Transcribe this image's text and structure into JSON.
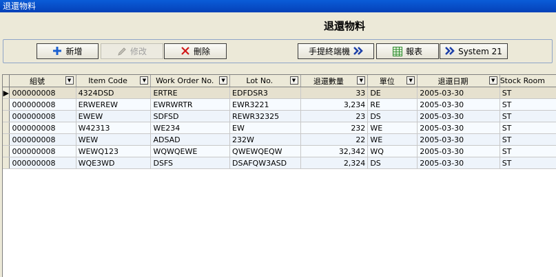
{
  "window": {
    "title": "退還物料"
  },
  "page": {
    "heading": "退還物料"
  },
  "toolbar": {
    "new_label": "新增",
    "edit_label": "修改",
    "delete_label": "刪除",
    "handheld_label": "手提終端機",
    "report_label": "報表",
    "system21_label": "System 21"
  },
  "icons": {
    "new": "plus-icon",
    "edit": "pencil-icon",
    "delete": "x-icon",
    "handheld": "double-chevron-right-icon",
    "report": "spreadsheet-icon",
    "system21": "double-chevron-right-icon"
  },
  "colors": {
    "titlebar": "#0541b8",
    "plus": "#1a5fd0",
    "delete": "#d01818",
    "chevron": "#1c3fa8",
    "report": "#2e8b2e"
  },
  "grid": {
    "columns": [
      "組號",
      "Item Code",
      "Work Order No.",
      "Lot No.",
      "退還數量",
      "單位",
      "退還日期",
      "Stock Room"
    ],
    "rows": [
      [
        "000000008",
        "4324DSD",
        "ERTRE",
        "EDFDSR3",
        "33",
        "DE",
        "2005-03-30",
        "ST"
      ],
      [
        "000000008",
        "ERWEREW",
        "EWRWRTR",
        "EWR3221",
        "3,234",
        "RE",
        "2005-03-30",
        "ST"
      ],
      [
        "000000008",
        "EWEW",
        "SDFSD",
        "REWR32325",
        "23",
        "DS",
        "2005-03-30",
        "ST"
      ],
      [
        "000000008",
        "W42313",
        "WE234",
        "EW",
        "232",
        "WE",
        "2005-03-30",
        "ST"
      ],
      [
        "000000008",
        "WEW",
        "ADSAD",
        "232W",
        "22",
        "WE",
        "2005-03-30",
        "ST"
      ],
      [
        "000000008",
        "WEWQ123",
        "WQWQEWE",
        "QWEWQEQW",
        "32,342",
        "WQ",
        "2005-03-30",
        "ST"
      ],
      [
        "000000008",
        "WQE3WD",
        "DSFS",
        "DSAFQW3ASD",
        "2,324",
        "DS",
        "2005-03-30",
        "ST"
      ]
    ],
    "current_row_marker": "▶"
  }
}
